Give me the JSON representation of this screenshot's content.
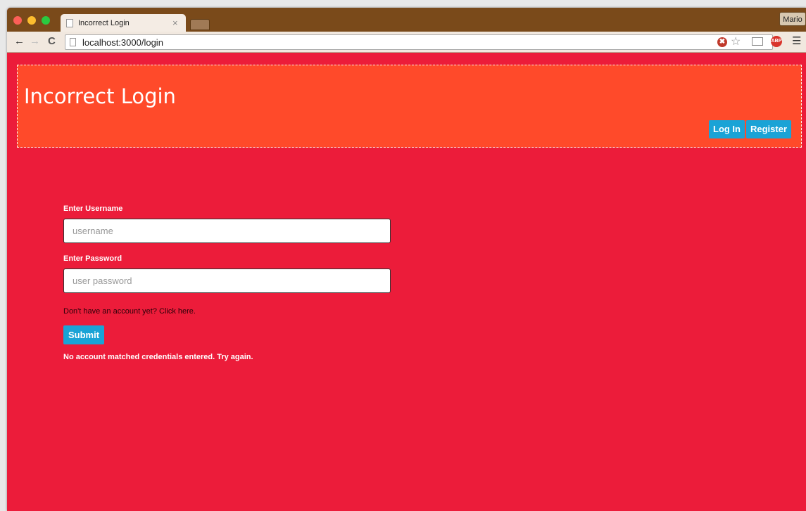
{
  "browser": {
    "tab_title": "Incorrect Login",
    "tab_close": "×",
    "url": "localhost:3000/login",
    "profile_name": "Mario",
    "abp_label": "ABP"
  },
  "header": {
    "title": "Incorrect Login",
    "login_label": "Log In",
    "register_label": "Register"
  },
  "form": {
    "username_label": "Enter Username",
    "username_placeholder": "username",
    "password_label": "Enter Password",
    "password_placeholder": "user password",
    "signup_text": "Don't have an account yet? Click here.",
    "submit_label": "Submit",
    "error_text": "No account matched credentials entered. Try again."
  },
  "colors": {
    "page_bg": "#ec1c3a",
    "header_bg": "#ff4a2a",
    "button_bg": "#1aa3d6",
    "chrome_titlebar": "#7a4a1a"
  }
}
